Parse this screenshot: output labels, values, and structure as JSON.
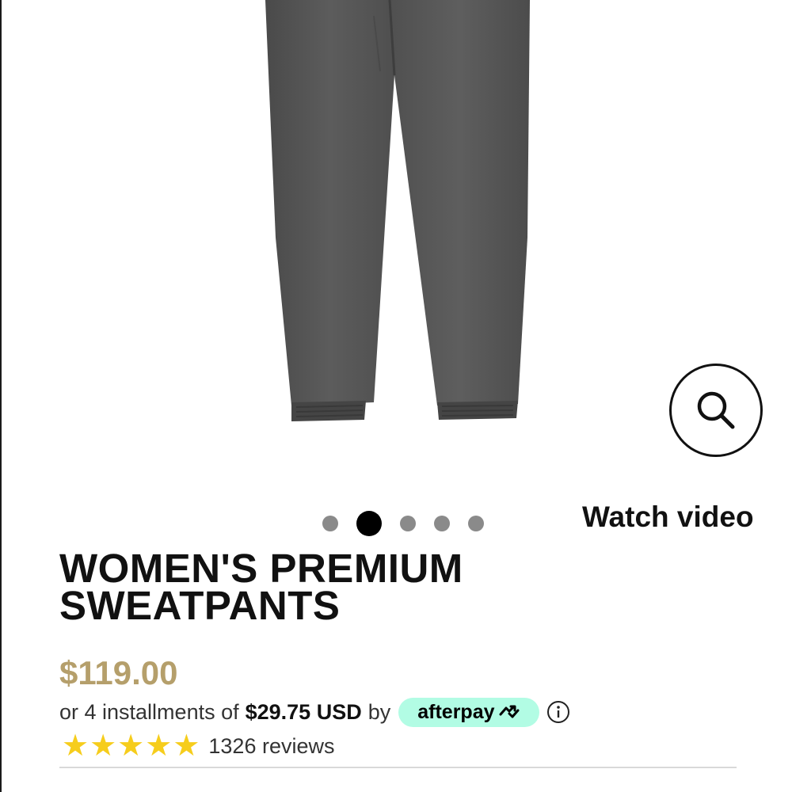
{
  "product": {
    "title_line1": "WOMEN'S PREMIUM",
    "title_line2": "SWEATPANTS",
    "price": "$119.00",
    "image_icon": "sweatpants-photo"
  },
  "gallery": {
    "zoom_icon": "search-icon",
    "watch_video_label": "Watch video",
    "dots_total": 5,
    "active_dot": 2
  },
  "payment": {
    "prefix": "or 4 installments of",
    "amount": "$29.75 USD",
    "by": "by",
    "provider": "afterpay",
    "info_icon": "info-icon"
  },
  "reviews": {
    "rating": 5,
    "max_rating": 5,
    "count_label": "1326 reviews"
  },
  "colors": {
    "price": "#b59f6b",
    "star": "#f6cd1c",
    "afterpay_badge": "#b2fce4",
    "dot_inactive": "#8a8a8a",
    "dot_active": "#000000"
  }
}
